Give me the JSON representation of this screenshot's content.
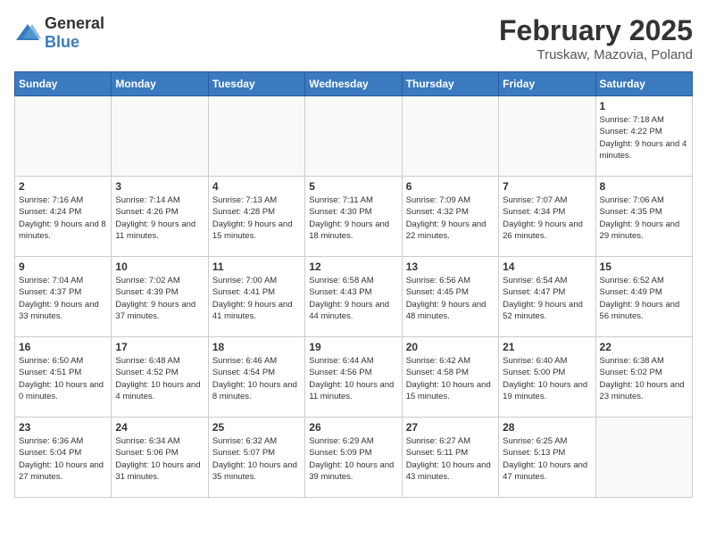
{
  "logo": {
    "general": "General",
    "blue": "Blue"
  },
  "title": "February 2025",
  "subtitle": "Truskaw, Mazovia, Poland",
  "days_of_week": [
    "Sunday",
    "Monday",
    "Tuesday",
    "Wednesday",
    "Thursday",
    "Friday",
    "Saturday"
  ],
  "weeks": [
    [
      {
        "day": "",
        "info": ""
      },
      {
        "day": "",
        "info": ""
      },
      {
        "day": "",
        "info": ""
      },
      {
        "day": "",
        "info": ""
      },
      {
        "day": "",
        "info": ""
      },
      {
        "day": "",
        "info": ""
      },
      {
        "day": "1",
        "info": "Sunrise: 7:18 AM\nSunset: 4:22 PM\nDaylight: 9 hours and 4 minutes."
      }
    ],
    [
      {
        "day": "2",
        "info": "Sunrise: 7:16 AM\nSunset: 4:24 PM\nDaylight: 9 hours and 8 minutes."
      },
      {
        "day": "3",
        "info": "Sunrise: 7:14 AM\nSunset: 4:26 PM\nDaylight: 9 hours and 11 minutes."
      },
      {
        "day": "4",
        "info": "Sunrise: 7:13 AM\nSunset: 4:28 PM\nDaylight: 9 hours and 15 minutes."
      },
      {
        "day": "5",
        "info": "Sunrise: 7:11 AM\nSunset: 4:30 PM\nDaylight: 9 hours and 18 minutes."
      },
      {
        "day": "6",
        "info": "Sunrise: 7:09 AM\nSunset: 4:32 PM\nDaylight: 9 hours and 22 minutes."
      },
      {
        "day": "7",
        "info": "Sunrise: 7:07 AM\nSunset: 4:34 PM\nDaylight: 9 hours and 26 minutes."
      },
      {
        "day": "8",
        "info": "Sunrise: 7:06 AM\nSunset: 4:35 PM\nDaylight: 9 hours and 29 minutes."
      }
    ],
    [
      {
        "day": "9",
        "info": "Sunrise: 7:04 AM\nSunset: 4:37 PM\nDaylight: 9 hours and 33 minutes."
      },
      {
        "day": "10",
        "info": "Sunrise: 7:02 AM\nSunset: 4:39 PM\nDaylight: 9 hours and 37 minutes."
      },
      {
        "day": "11",
        "info": "Sunrise: 7:00 AM\nSunset: 4:41 PM\nDaylight: 9 hours and 41 minutes."
      },
      {
        "day": "12",
        "info": "Sunrise: 6:58 AM\nSunset: 4:43 PM\nDaylight: 9 hours and 44 minutes."
      },
      {
        "day": "13",
        "info": "Sunrise: 6:56 AM\nSunset: 4:45 PM\nDaylight: 9 hours and 48 minutes."
      },
      {
        "day": "14",
        "info": "Sunrise: 6:54 AM\nSunset: 4:47 PM\nDaylight: 9 hours and 52 minutes."
      },
      {
        "day": "15",
        "info": "Sunrise: 6:52 AM\nSunset: 4:49 PM\nDaylight: 9 hours and 56 minutes."
      }
    ],
    [
      {
        "day": "16",
        "info": "Sunrise: 6:50 AM\nSunset: 4:51 PM\nDaylight: 10 hours and 0 minutes."
      },
      {
        "day": "17",
        "info": "Sunrise: 6:48 AM\nSunset: 4:52 PM\nDaylight: 10 hours and 4 minutes."
      },
      {
        "day": "18",
        "info": "Sunrise: 6:46 AM\nSunset: 4:54 PM\nDaylight: 10 hours and 8 minutes."
      },
      {
        "day": "19",
        "info": "Sunrise: 6:44 AM\nSunset: 4:56 PM\nDaylight: 10 hours and 11 minutes."
      },
      {
        "day": "20",
        "info": "Sunrise: 6:42 AM\nSunset: 4:58 PM\nDaylight: 10 hours and 15 minutes."
      },
      {
        "day": "21",
        "info": "Sunrise: 6:40 AM\nSunset: 5:00 PM\nDaylight: 10 hours and 19 minutes."
      },
      {
        "day": "22",
        "info": "Sunrise: 6:38 AM\nSunset: 5:02 PM\nDaylight: 10 hours and 23 minutes."
      }
    ],
    [
      {
        "day": "23",
        "info": "Sunrise: 6:36 AM\nSunset: 5:04 PM\nDaylight: 10 hours and 27 minutes."
      },
      {
        "day": "24",
        "info": "Sunrise: 6:34 AM\nSunset: 5:06 PM\nDaylight: 10 hours and 31 minutes."
      },
      {
        "day": "25",
        "info": "Sunrise: 6:32 AM\nSunset: 5:07 PM\nDaylight: 10 hours and 35 minutes."
      },
      {
        "day": "26",
        "info": "Sunrise: 6:29 AM\nSunset: 5:09 PM\nDaylight: 10 hours and 39 minutes."
      },
      {
        "day": "27",
        "info": "Sunrise: 6:27 AM\nSunset: 5:11 PM\nDaylight: 10 hours and 43 minutes."
      },
      {
        "day": "28",
        "info": "Sunrise: 6:25 AM\nSunset: 5:13 PM\nDaylight: 10 hours and 47 minutes."
      },
      {
        "day": "",
        "info": ""
      }
    ]
  ]
}
